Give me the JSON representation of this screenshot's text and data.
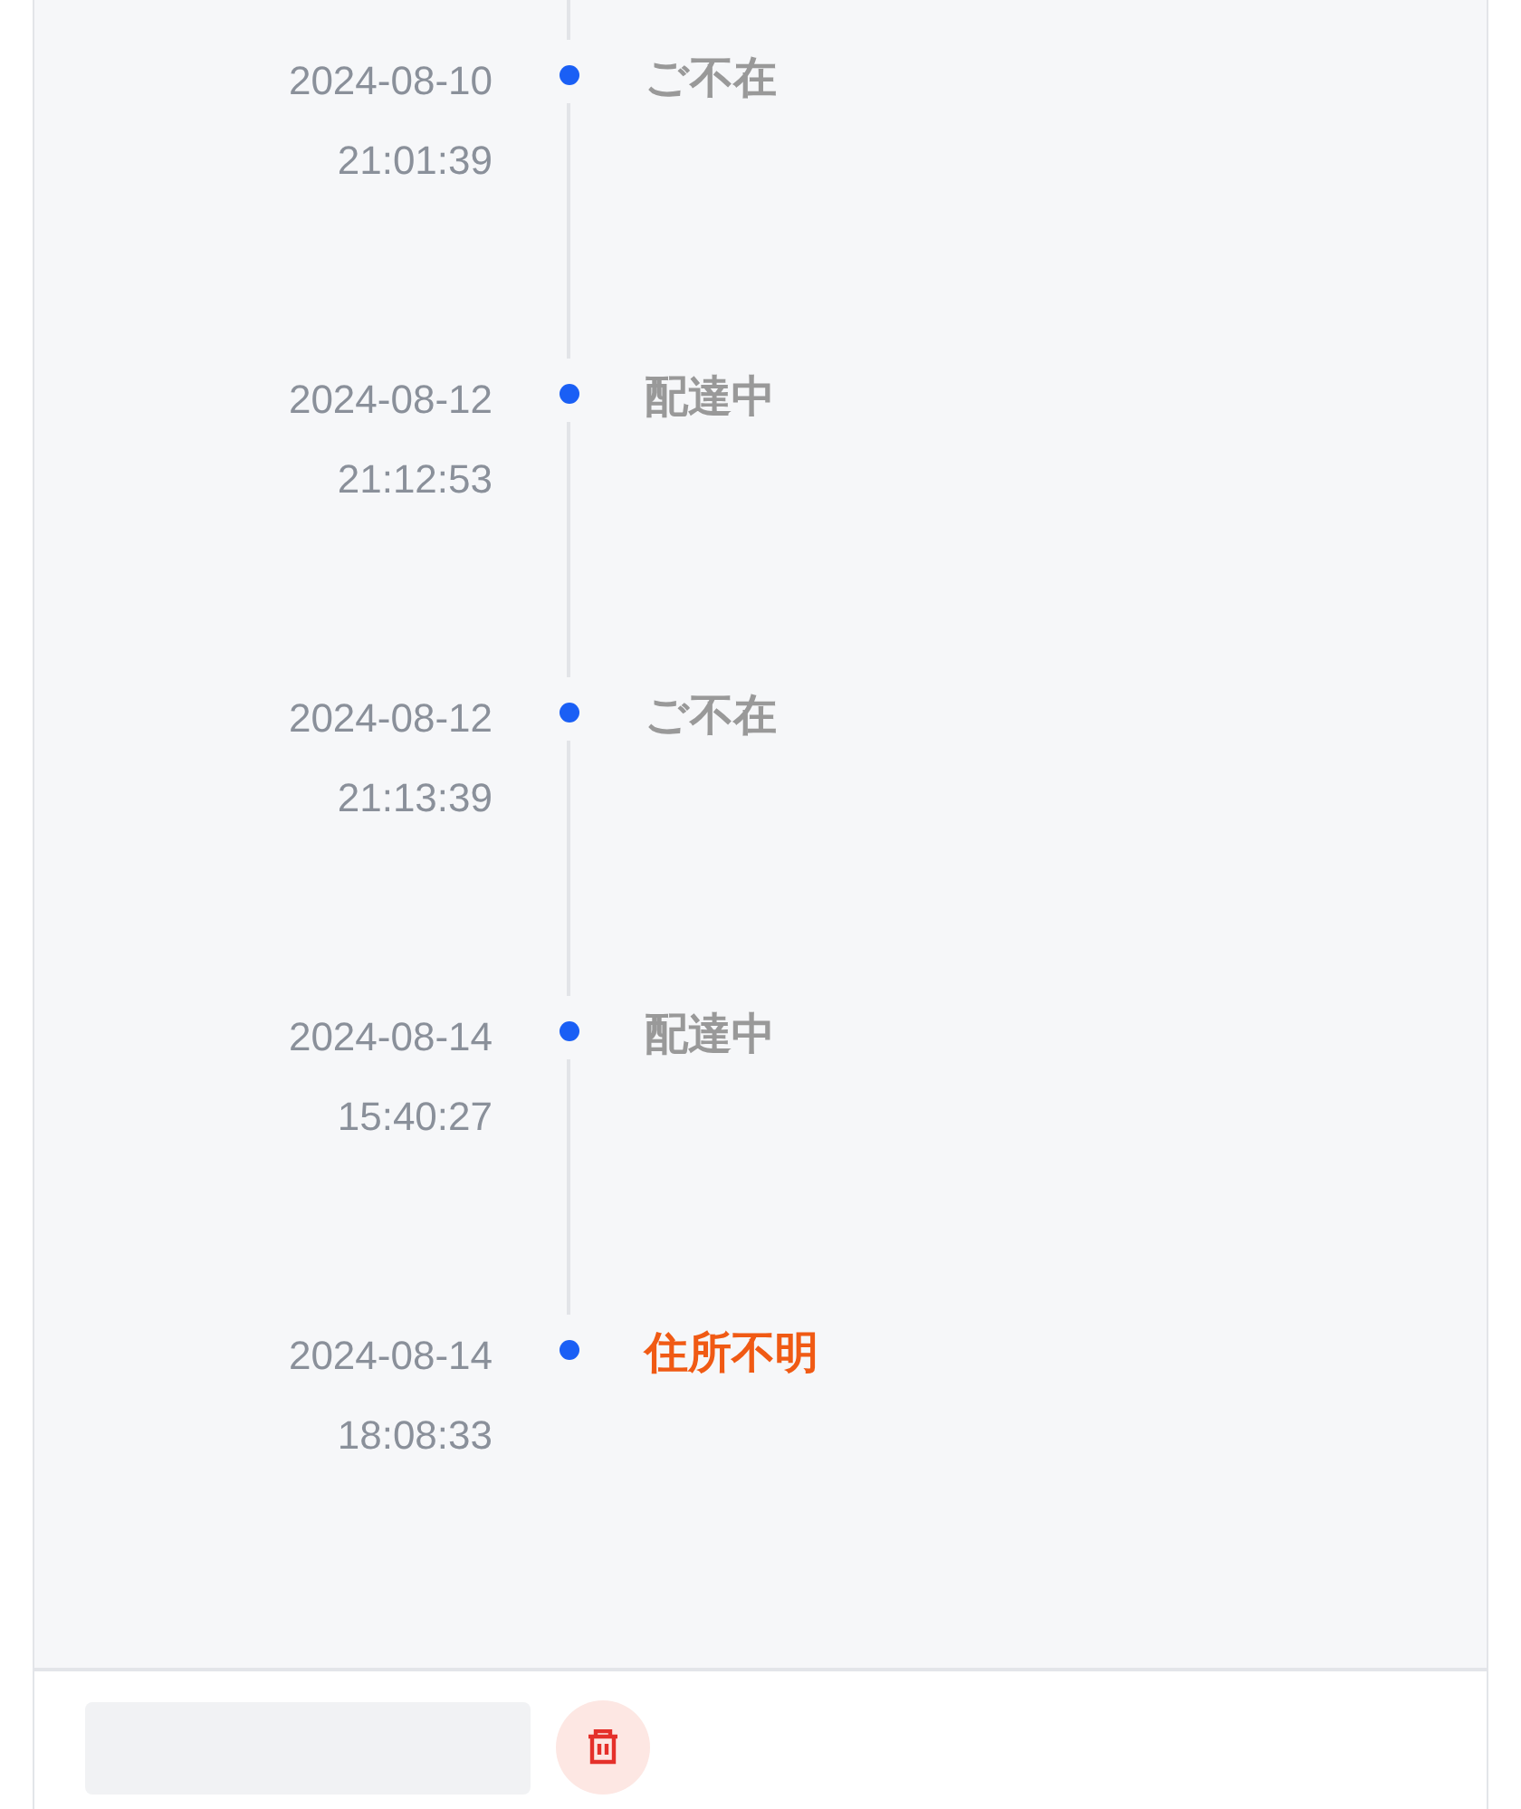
{
  "events": [
    {
      "date": "2024-08-10",
      "time": "21:01:39",
      "status": "ご不在",
      "highlighted": false
    },
    {
      "date": "2024-08-12",
      "time": "21:12:53",
      "status": "配達中",
      "highlighted": false
    },
    {
      "date": "2024-08-12",
      "time": "21:13:39",
      "status": "ご不在",
      "highlighted": false
    },
    {
      "date": "2024-08-14",
      "time": "15:40:27",
      "status": "配達中",
      "highlighted": false
    },
    {
      "date": "2024-08-14",
      "time": "18:08:33",
      "status": "住所不明",
      "highlighted": true
    }
  ]
}
